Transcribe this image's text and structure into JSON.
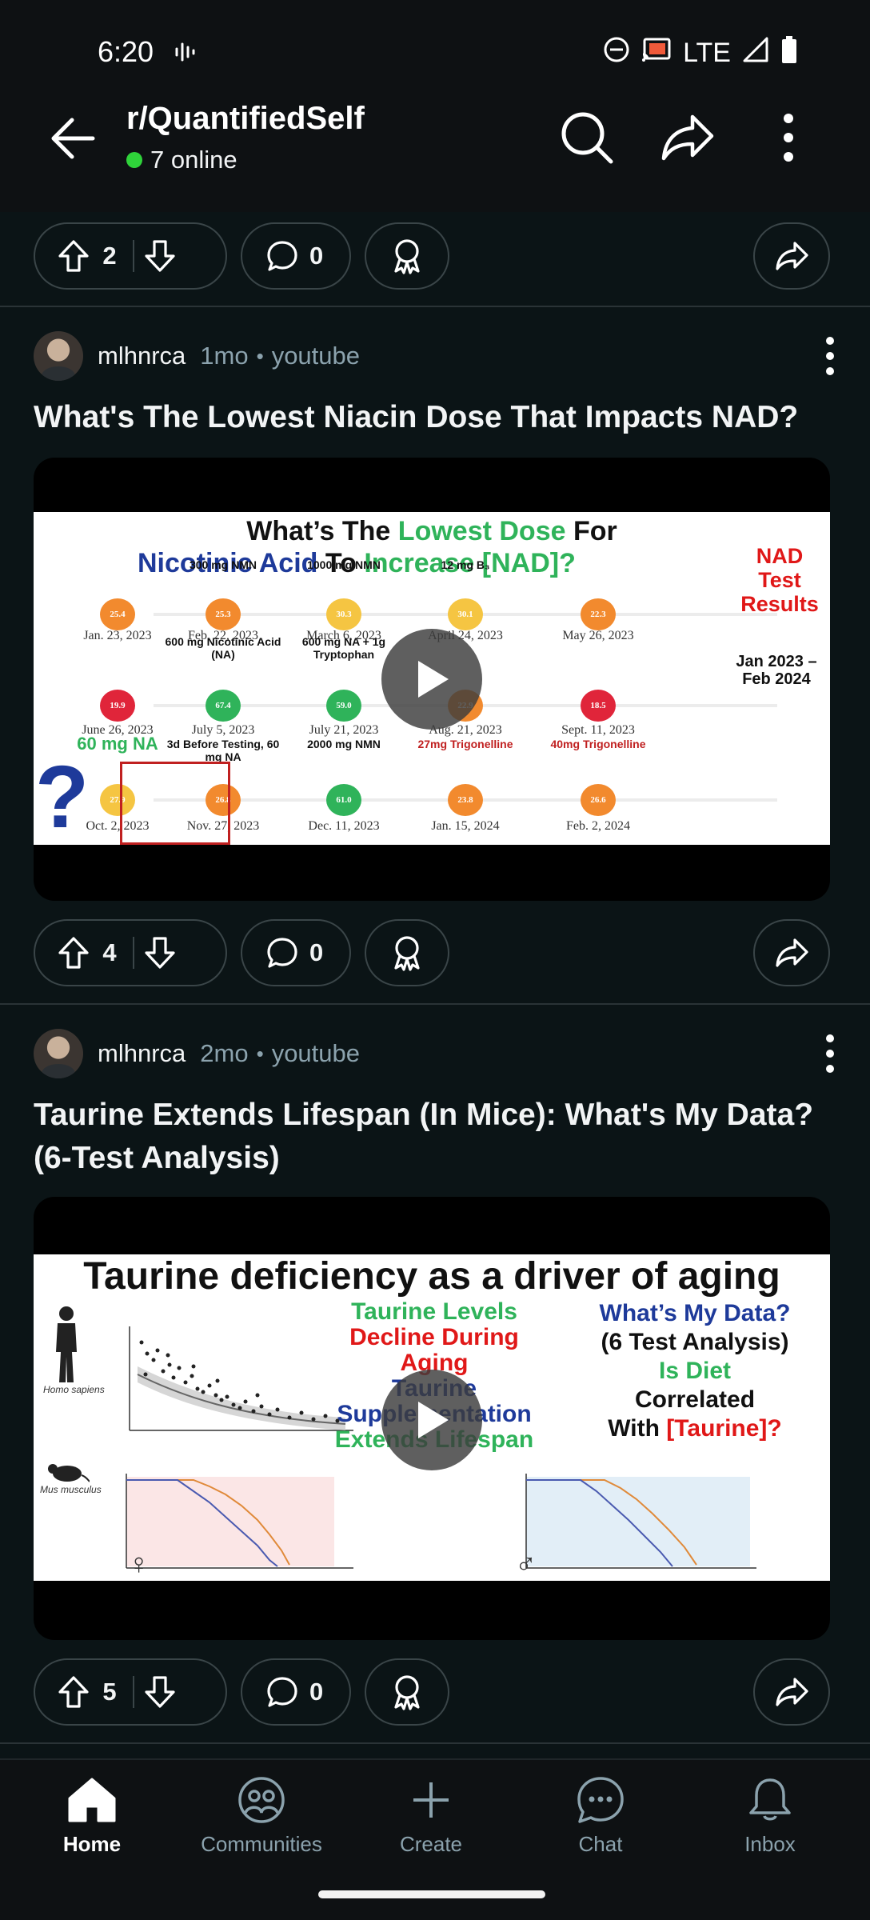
{
  "status_bar": {
    "time": "6:20",
    "network": "LTE"
  },
  "header": {
    "title": "r/QuantifiedSelf",
    "online_text": "7 online"
  },
  "top_actions": {
    "votes": "2",
    "comments": "0"
  },
  "posts": [
    {
      "author": "mlhnrca",
      "age": "1mo",
      "source": "youtube",
      "title": "What's The Lowest Niacin Dose That Impacts NAD?",
      "votes": "4",
      "comments": "0",
      "thumb": {
        "line1a": "What’s The ",
        "line1b": "Lowest Dose",
        "line1c": " For",
        "line2a": "Nicotinic Acid",
        "line2b": " To ",
        "line2c": "Increase [NAD]?",
        "side1": "NAD",
        "side2": "Test",
        "side3": "Results",
        "range1": "Jan 2023 –",
        "range2": "Feb 2024",
        "row1_labels": [
          "",
          "300 mg NMN",
          "1000 mg NMN",
          "12 mg B₃",
          ""
        ],
        "row1_values": [
          "25.4",
          "25.3",
          "30.3",
          "30.1",
          "22.3"
        ],
        "row1_dates": [
          "Jan. 23, 2023",
          "Feb. 22, 2023",
          "March 6, 2023",
          "April 24, 2023",
          "May 26, 2023"
        ],
        "row2_labels": [
          "",
          "600 mg Nicotinic Acid (NA)",
          "600 mg NA + 1g Tryptophan",
          "",
          ""
        ],
        "row2_values": [
          "19.9",
          "67.4",
          "59.0",
          "22.9",
          "18.5"
        ],
        "row2_dates": [
          "June 26, 2023",
          "July 5, 2023",
          "July 21, 2023",
          "Aug. 21, 2023",
          "Sept. 11, 2023"
        ],
        "row3_labels": [
          "60 mg NA",
          "3d Before Testing, 60 mg NA",
          "2000 mg NMN",
          "27mg Trigonelline",
          "40mg Trigonelline"
        ],
        "row3_values": [
          "27.9",
          "26.8",
          "61.0",
          "23.8",
          "26.6"
        ],
        "row3_dates": [
          "Oct. 2, 2023",
          "Nov. 27, 2023",
          "Dec. 11, 2023",
          "Jan. 15, 2024",
          "Feb. 2, 2024"
        ],
        "question_mark": "?"
      }
    },
    {
      "author": "mlhnrca",
      "age": "2mo",
      "source": "youtube",
      "title": "Taurine Extends Lifespan (In Mice): What's My Data? (6-Test Analysis)",
      "votes": "5",
      "comments": "0",
      "thumb": {
        "headline": "Taurine deficiency as a driver of aging",
        "green1": "Taurine Levels",
        "red1": "Decline During",
        "red2": "Aging",
        "blue1": "Taurine",
        "blue2": "Supplementation",
        "green2": "Extends Lifespan",
        "blue3": "What’s My Data?",
        "black1": "(6 Test Analysis)",
        "green3": "Is Diet",
        "black2": "Correlated",
        "black3": "With ",
        "red3": "[Taurine]?",
        "species1": "Homo sapiens",
        "species2": "Mus musculus",
        "female_symbol": "♀",
        "male_symbol": "♂"
      }
    }
  ],
  "nav": {
    "items": [
      {
        "label": "Home"
      },
      {
        "label": "Communities"
      },
      {
        "label": "Create"
      },
      {
        "label": "Chat"
      },
      {
        "label": "Inbox"
      }
    ]
  },
  "colors": {
    "background": "#0b1416",
    "online": "#2fd33a",
    "nad_green": "#2fb35a",
    "nad_blue": "#1e3a9a",
    "nad_red": "#e01818",
    "bubble_orange": "#f28a2e"
  }
}
